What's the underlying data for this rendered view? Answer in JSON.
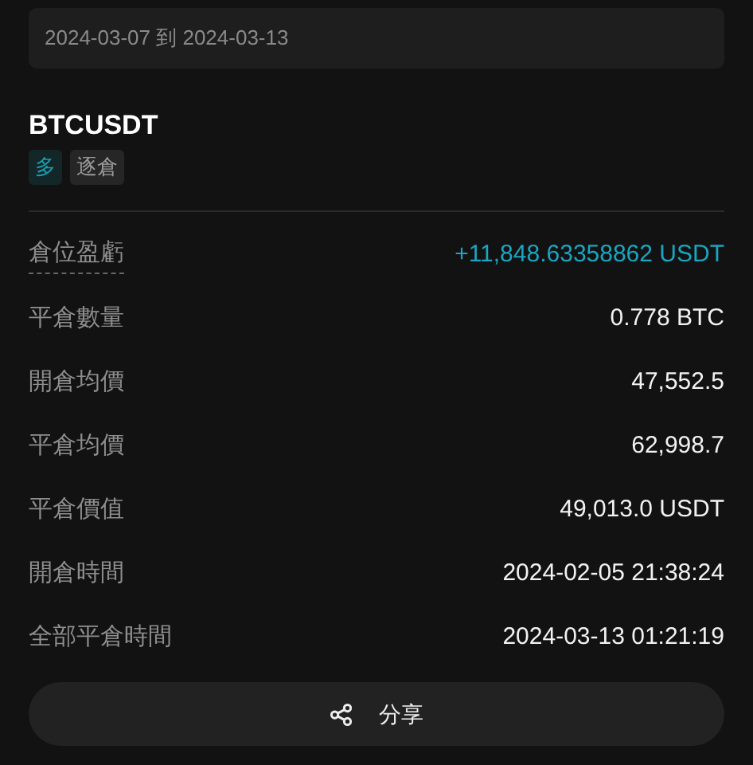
{
  "date_range": {
    "value": "2024-03-07 到 2024-03-13"
  },
  "symbol": "BTCUSDT",
  "tags": [
    {
      "label": "多",
      "color": "#1a9fb0"
    },
    {
      "label": "逐倉",
      "color": "#9a9a9a"
    }
  ],
  "rows": [
    {
      "kind": "pnl",
      "label": "倉位盈虧",
      "value": "+11,848.63358862 USDT"
    },
    {
      "kind": "plain",
      "label": "平倉數量",
      "value": "0.778 BTC"
    },
    {
      "kind": "plain",
      "label": "開倉均價",
      "value": "47,552.5"
    },
    {
      "kind": "plain",
      "label": "平倉均價",
      "value": "62,998.7"
    },
    {
      "kind": "plain",
      "label": "平倉價值",
      "value": "49,013.0 USDT"
    },
    {
      "kind": "plain",
      "label": "開倉時間",
      "value": "2024-02-05 21:38:24"
    },
    {
      "kind": "plain",
      "label": "全部平倉時間",
      "value": "2024-03-13 01:21:19"
    }
  ],
  "share_button": {
    "label": "分享"
  }
}
